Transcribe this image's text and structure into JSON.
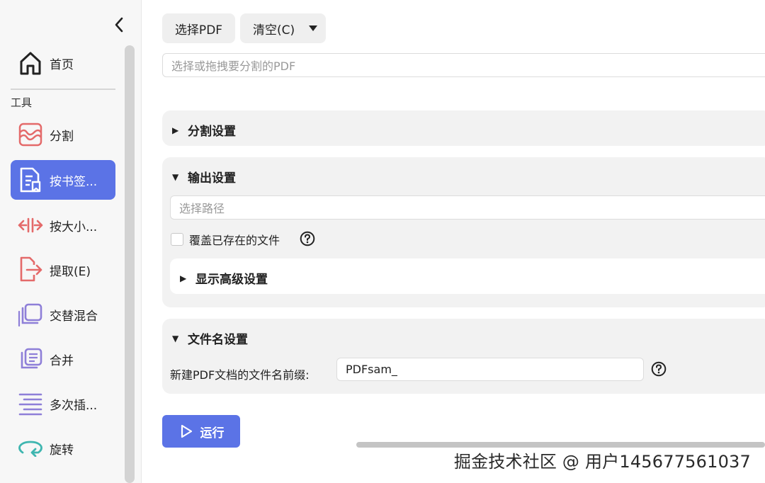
{
  "sidebar": {
    "home_label": "首页",
    "section_label": "工具",
    "items": [
      {
        "label": "分割",
        "icon": "split-icon",
        "color": "#e46a6a"
      },
      {
        "label": "按书签...",
        "icon": "bookmark-doc-icon",
        "color": "#ffffff",
        "active": true
      },
      {
        "label": "按大小...",
        "icon": "size-split-icon",
        "color": "#e46a6a"
      },
      {
        "label": "提取(E)",
        "icon": "extract-icon",
        "color": "#e46a6a"
      },
      {
        "label": "交替混合",
        "icon": "alternate-mix-icon",
        "color": "#8e7fd8"
      },
      {
        "label": "合并",
        "icon": "merge-icon",
        "color": "#8e7fd8"
      },
      {
        "label": "多次插...",
        "icon": "multi-insert-icon",
        "color": "#8e7fd8"
      },
      {
        "label": "旋转",
        "icon": "rotate-icon",
        "color": "#3fb6b0"
      }
    ]
  },
  "toolbar": {
    "select_pdf_label": "选择PDF",
    "clear_label": "清空(C)"
  },
  "pdf_input": {
    "placeholder": "选择或拖拽要分割的PDF"
  },
  "split_settings": {
    "title": "分割设置"
  },
  "output_settings": {
    "title": "输出设置",
    "path_placeholder": "选择路径",
    "overwrite_label": "覆盖已存在的文件",
    "advanced_title": "显示高级设置"
  },
  "filename_settings": {
    "title": "文件名设置",
    "prefix_label": "新建PDF文档的文件名前缀:",
    "prefix_value": "PDFsam_"
  },
  "run_label": "运行",
  "watermark": "掘金技术社区 @ 用户145677561037",
  "colors": {
    "accent": "#5b73e6"
  }
}
